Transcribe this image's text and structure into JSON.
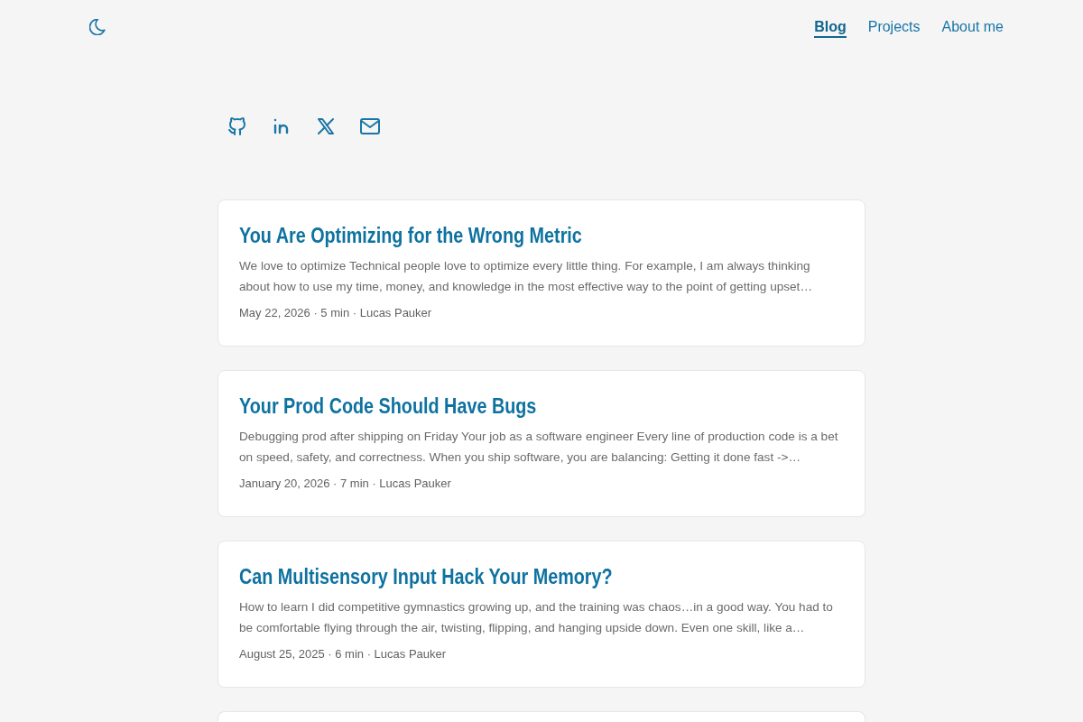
{
  "nav": [
    {
      "label": "Blog",
      "selected": true
    },
    {
      "label": "Projects",
      "selected": false
    },
    {
      "label": "About me",
      "selected": false
    }
  ],
  "posts": [
    {
      "title": "You Are Optimizing for the Wrong Metric",
      "excerpt": "We love to optimize Technical people love to optimize every little thing. For example, I am always thinking about how to use my time, money, and knowledge in the most effective way to the point of getting upset…",
      "meta": "May 22, 2026 · 5 min · Lucas Pauker"
    },
    {
      "title": "Your Prod Code Should Have Bugs",
      "excerpt": "Debugging prod after shipping on Friday Your job as a software engineer Every line of production code is a bet on speed, safety, and correctness. When you ship software, you are balancing: Getting it done fast ->…",
      "meta": "January 20, 2026 · 7 min · Lucas Pauker"
    },
    {
      "title": "Can Multisensory Input Hack Your Memory?",
      "excerpt": "How to learn I did competitive gymnastics growing up, and the training was chaos…in a good way. You had to be comfortable flying through the air, twisting, flipping, and hanging upside down. Even one skill, like a…",
      "meta": "August 25, 2025 · 6 min · Lucas Pauker"
    }
  ]
}
